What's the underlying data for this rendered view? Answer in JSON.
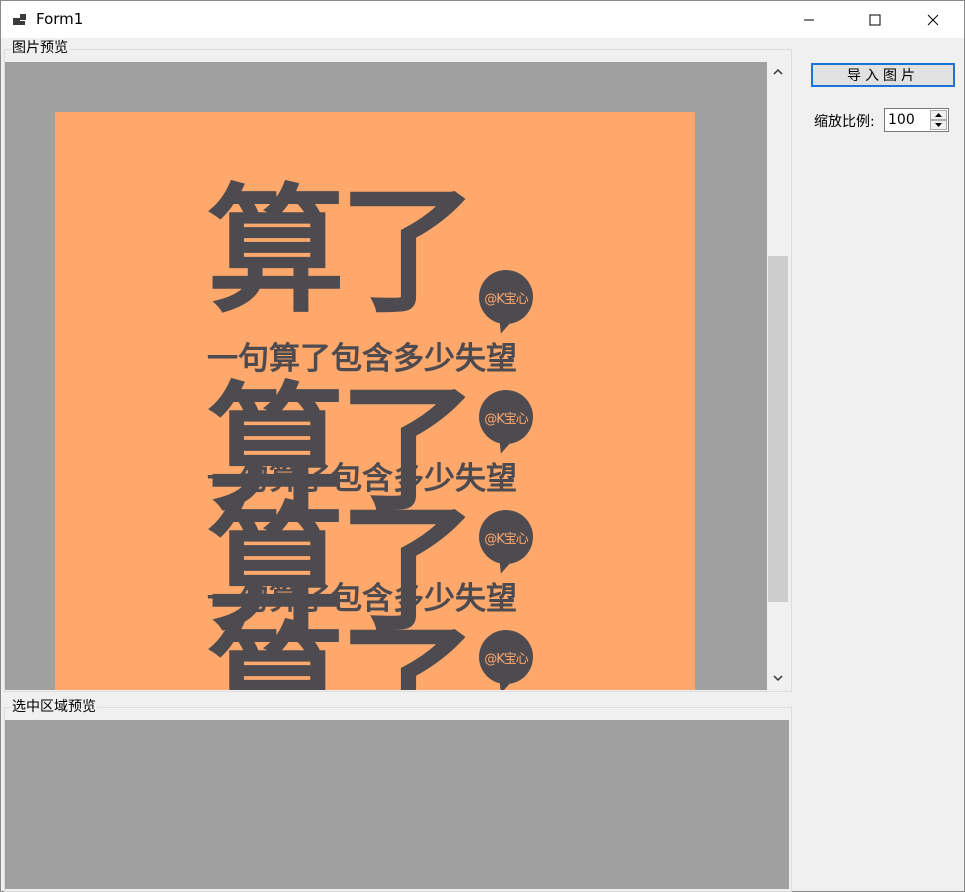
{
  "window": {
    "title": "Form1"
  },
  "groups": {
    "image_preview": "图片预览",
    "selection_preview": "选中区域预览"
  },
  "poster": {
    "big_line_1": "算了",
    "big_line_2": "算了",
    "big_line_3": "算了",
    "big_line_4": "算了",
    "sub_line": "一句算了包含多少失望",
    "watermark": "@K宝心"
  },
  "controls": {
    "import_button": "导入图片",
    "scale_label": "缩放比例:",
    "scale_value": "100"
  },
  "colors": {
    "poster_bg": "#ffa86b",
    "ink": "#4e4b50",
    "focus_border": "#1b74d4"
  }
}
